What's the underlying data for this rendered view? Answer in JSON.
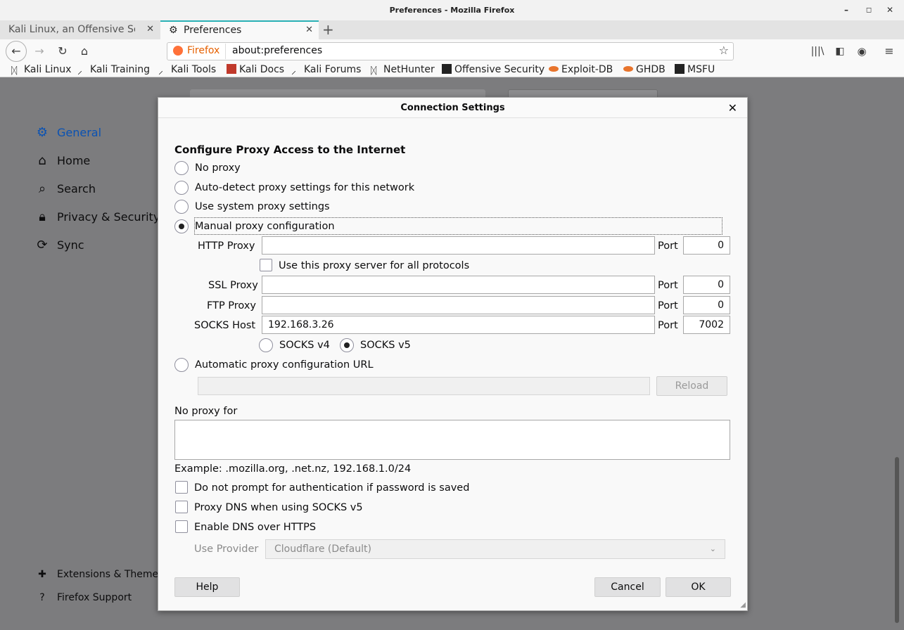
{
  "window": {
    "title": "Preferences - Mozilla Firefox",
    "min": "–",
    "max": "◻",
    "close": "✕"
  },
  "tabs": [
    {
      "label": "Kali Linux, an Offensive Security",
      "close": "✕"
    },
    {
      "label": "Preferences",
      "close": "✕"
    }
  ],
  "newtab": "+",
  "nav": {
    "identity": "Firefox",
    "url": "about:preferences"
  },
  "bookmarks": [
    "Kali Linux",
    "Kali Training",
    "Kali Tools",
    "Kali Docs",
    "Kali Forums",
    "NetHunter",
    "Offensive Security",
    "Exploit-DB",
    "GHDB",
    "MSFU"
  ],
  "sidebar": {
    "items": [
      {
        "label": "General",
        "icon": "gear-icon"
      },
      {
        "label": "Home",
        "icon": "home-icon"
      },
      {
        "label": "Search",
        "icon": "search-icon"
      },
      {
        "label": "Privacy & Security",
        "icon": "lock-icon"
      },
      {
        "label": "Sync",
        "icon": "sync-icon"
      }
    ],
    "footer": [
      {
        "label": "Extensions & Themes",
        "icon": "puzzle-icon"
      },
      {
        "label": "Firefox Support",
        "icon": "help-icon"
      }
    ]
  },
  "dialog": {
    "title": "Connection Settings",
    "heading": "Configure Proxy Access to the Internet",
    "options": [
      "No proxy",
      "Auto-detect proxy settings for this network",
      "Use system proxy settings",
      "Manual proxy configuration",
      "Automatic proxy configuration URL"
    ],
    "selected_option": "Manual proxy configuration",
    "http_proxy_label": "HTTP Proxy",
    "http_proxy": "",
    "port_label": "Port",
    "http_port": "0",
    "use_for_all": "Use this proxy server for all protocols",
    "ssl_proxy_label": "SSL Proxy",
    "ssl_proxy": "",
    "ssl_port": "0",
    "ftp_proxy_label": "FTP Proxy",
    "ftp_proxy": "",
    "ftp_port": "0",
    "socks_host_label": "SOCKS Host",
    "socks_host": "192.168.3.26",
    "socks_port": "7002",
    "socks_v4": "SOCKS v4",
    "socks_v5": "SOCKS v5",
    "socks_version_selected": "SOCKS v5",
    "autoconfig_url": "",
    "reload": "Reload",
    "no_proxy_label": "No proxy for",
    "no_proxy_value": "",
    "example": "Example: .mozilla.org, .net.nz, 192.168.1.0/24",
    "no_prompt_auth": "Do not prompt for authentication if password is saved",
    "proxy_dns": "Proxy DNS when using SOCKS v5",
    "enable_doh": "Enable DNS over HTTPS",
    "use_provider_label": "Use Provider",
    "provider": "Cloudflare (Default)",
    "help": "Help",
    "cancel": "Cancel",
    "ok": "OK"
  }
}
